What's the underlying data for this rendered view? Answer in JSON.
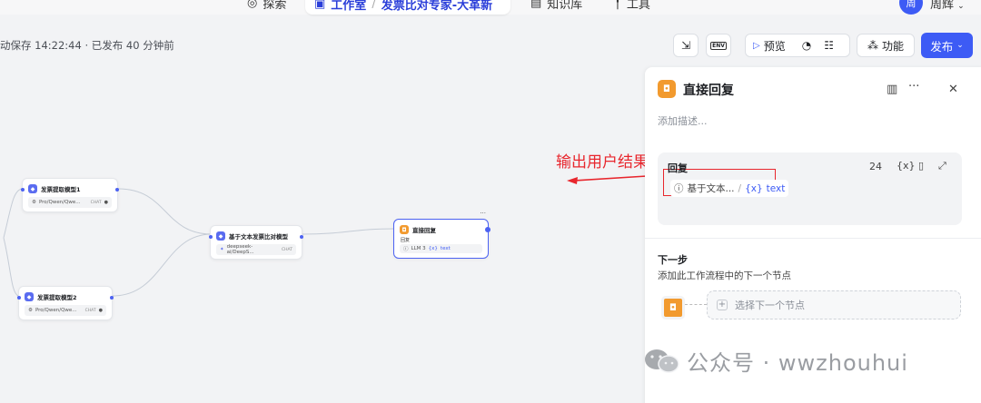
{
  "topnav": {
    "search_label": "探索",
    "workspace_label": "工作室",
    "breadcrumb_sep": "/",
    "project_label": "发票比对专家-大革新",
    "knowledge_label": "知识库",
    "tools_label": "工具",
    "avatar_text": "周",
    "user_name": "周辉"
  },
  "toolbar": {
    "save_status": "动保存 14:22:44 · 已发布 40 分钟前",
    "env_label": "ENV",
    "preview_label": "预览",
    "features_label": "功能",
    "publish_label": "发布"
  },
  "nodes": {
    "extract1": {
      "title": "发票提取模型1",
      "model": "Pro/Qwen/Qwe...",
      "tag": "CHAT"
    },
    "extract2": {
      "title": "发票提取模型2",
      "model": "Pro/Qwen/Qwe...",
      "tag": "CHAT"
    },
    "compare": {
      "title": "基于文本发票比对模型",
      "model": "deepseek-ai/DeepS...",
      "tag": "CHAT"
    },
    "reply": {
      "title": "直接回复",
      "label": "回复",
      "ref_source": "LLM 3",
      "ref_var": "text"
    },
    "more_icon": "···"
  },
  "annotation": "输出用户结果信息",
  "panel": {
    "title": "直接回复",
    "description_placeholder": "添加描述...",
    "reply_label": "回复",
    "char_count": "24",
    "var_icon": "{x}",
    "var_source": "基于文本...",
    "var_sep": "/",
    "var_name": "text",
    "next_title": "下一步",
    "next_desc": "添加此工作流程中的下一个节点",
    "next_select_placeholder": "选择下一个节点"
  },
  "watermark": "公众号 · wwzhouhui",
  "colors": {
    "accent": "#3d5bf5",
    "node_orange": "#f29a2e",
    "annotation_red": "#e8262d"
  }
}
